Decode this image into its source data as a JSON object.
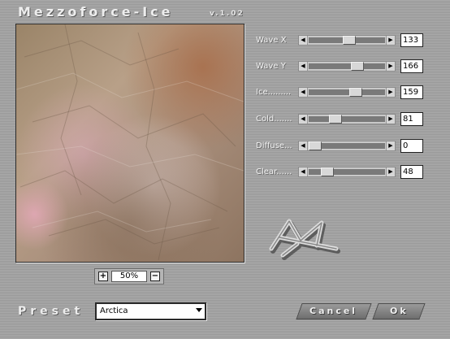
{
  "app": {
    "title": "Mezzoforce-Ice",
    "version": "v.1.02"
  },
  "preview": {
    "zoom": "50%",
    "zoom_in_icon": "plus-icon",
    "zoom_out_icon": "minus-icon"
  },
  "params": [
    {
      "label": "Wave X",
      "value": "133",
      "max": 255
    },
    {
      "label": "Wave Y",
      "value": "166",
      "max": 255
    },
    {
      "label": "Ice.........",
      "value": "159",
      "max": 255
    },
    {
      "label": "Cold.......",
      "value": "81",
      "max": 255
    },
    {
      "label": "Diffuse...",
      "value": "0",
      "max": 255
    },
    {
      "label": "Clear......",
      "value": "48",
      "max": 255
    }
  ],
  "preset": {
    "label": "Preset",
    "value": "Arctica"
  },
  "buttons": {
    "cancel": "Cancel",
    "ok": "Ok"
  }
}
